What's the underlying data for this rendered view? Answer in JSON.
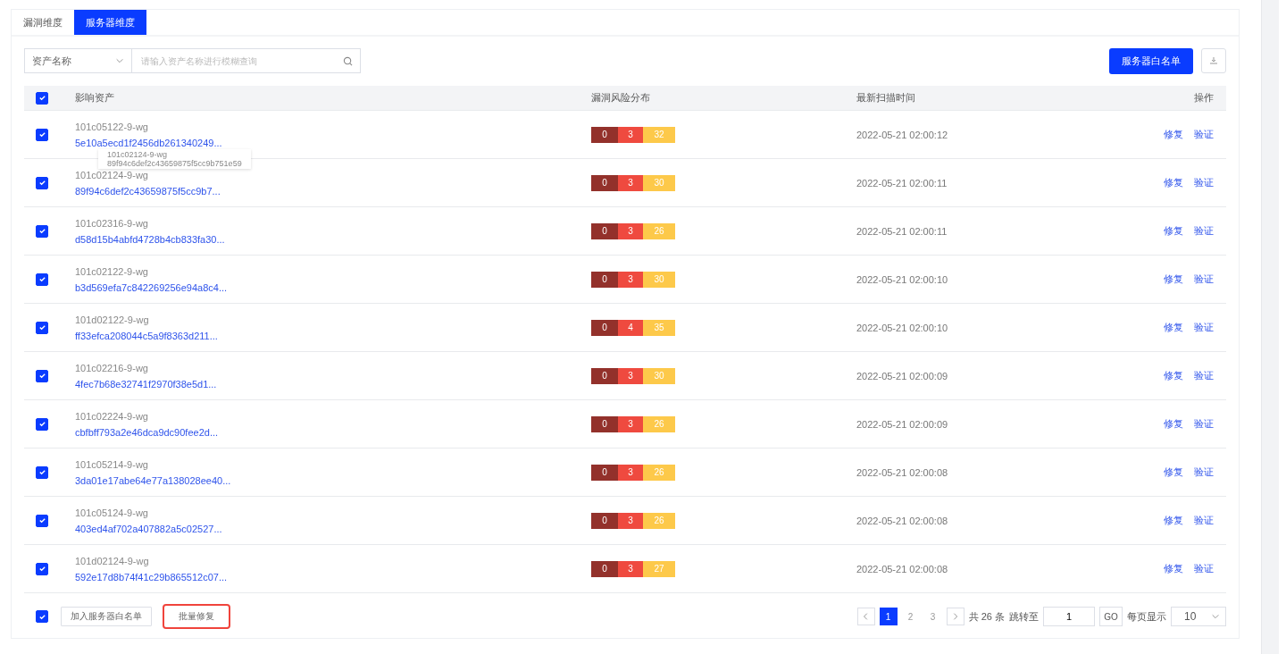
{
  "tabs": [
    {
      "label": "漏洞维度",
      "selected": false
    },
    {
      "label": "服务器维度",
      "selected": true
    }
  ],
  "filter": {
    "field": "资产名称",
    "placeholder": "请输入资产名称进行模糊查询"
  },
  "whitelist_button": "服务器白名单",
  "table": {
    "columns": [
      "影响资产",
      "漏洞风险分布",
      "最新扫描时间",
      "操作"
    ],
    "all_checked": true,
    "rows": [
      {
        "checked": true,
        "name": "101c05122-9-wg",
        "hash": "5e10a5ecd1f2456db261340249...",
        "risk": [
          "0",
          "3",
          "32"
        ],
        "time": "2022-05-21 02:00:12",
        "actions": [
          "修复",
          "验证"
        ]
      },
      {
        "checked": true,
        "name": "101c02124-9-wg",
        "hash": "89f94c6def2c43659875f5cc9b7...",
        "risk": [
          "0",
          "3",
          "30"
        ],
        "time": "2022-05-21 02:00:11",
        "actions": [
          "修复",
          "验证"
        ]
      },
      {
        "checked": true,
        "name": "101c02316-9-wg",
        "hash": "d58d15b4abfd4728b4cb833fa30...",
        "risk": [
          "0",
          "3",
          "26"
        ],
        "time": "2022-05-21 02:00:11",
        "actions": [
          "修复",
          "验证"
        ]
      },
      {
        "checked": true,
        "name": "101c02122-9-wg",
        "hash": "b3d569efa7c842269256e94a8c4...",
        "risk": [
          "0",
          "3",
          "30"
        ],
        "time": "2022-05-21 02:00:10",
        "actions": [
          "修复",
          "验证"
        ]
      },
      {
        "checked": true,
        "name": "101d02122-9-wg",
        "hash": "ff33efca208044c5a9f8363d211...",
        "risk": [
          "0",
          "4",
          "35"
        ],
        "time": "2022-05-21 02:00:10",
        "actions": [
          "修复",
          "验证"
        ]
      },
      {
        "checked": true,
        "name": "101c02216-9-wg",
        "hash": "4fec7b68e32741f2970f38e5d1...",
        "risk": [
          "0",
          "3",
          "30"
        ],
        "time": "2022-05-21 02:00:09",
        "actions": [
          "修复",
          "验证"
        ]
      },
      {
        "checked": true,
        "name": "101c02224-9-wg",
        "hash": "cbfbff793a2e46dca9dc90fee2d...",
        "risk": [
          "0",
          "3",
          "26"
        ],
        "time": "2022-05-21 02:00:09",
        "actions": [
          "修复",
          "验证"
        ]
      },
      {
        "checked": true,
        "name": "101c05214-9-wg",
        "hash": "3da01e17abe64e77a138028ee40...",
        "risk": [
          "0",
          "3",
          "26"
        ],
        "time": "2022-05-21 02:00:08",
        "actions": [
          "修复",
          "验证"
        ]
      },
      {
        "checked": true,
        "name": "101c05124-9-wg",
        "hash": "403ed4af702a407882a5c02527...",
        "risk": [
          "0",
          "3",
          "26"
        ],
        "time": "2022-05-21 02:00:08",
        "actions": [
          "修复",
          "验证"
        ]
      },
      {
        "checked": true,
        "name": "101d02124-9-wg",
        "hash": "592e17d8b74f41c29b865512c07...",
        "risk": [
          "0",
          "3",
          "27"
        ],
        "time": "2022-05-21 02:00:08",
        "actions": [
          "修复",
          "验证"
        ]
      }
    ]
  },
  "tooltip": {
    "lines": [
      "101c02124-9-wg",
      "89f94c6def2c43659875f5cc9b751e59"
    ]
  },
  "footer": {
    "checked": true,
    "buttons": [
      {
        "label": "加入服务器白名单",
        "highlighted": false
      },
      {
        "label": "批量修复",
        "highlighted": true
      }
    ]
  },
  "pagination": {
    "pages": [
      {
        "label": "1",
        "selected": true
      },
      {
        "label": "2",
        "selected": false
      },
      {
        "label": "3",
        "selected": false
      }
    ],
    "total": "共 26 条",
    "jump_label": "跳转至",
    "jump_value": "1",
    "go": "GO",
    "size_label": "每页显示",
    "size_value": "10"
  }
}
